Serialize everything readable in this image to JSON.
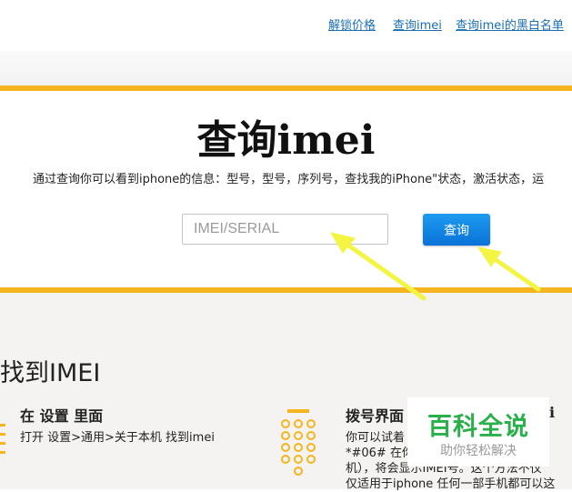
{
  "nav": {
    "links": [
      "解锁价格",
      "查询imei",
      "查询imei的黑白名单"
    ]
  },
  "hero": {
    "title": "查询imei",
    "subtitle": "通过查询你可以看到iphone的信息：型号，型号，序列号，查找我的iPhone\"状态，激活状态，运",
    "input_placeholder": "IMEI/SERIAL",
    "query_label": "查询"
  },
  "lower": {
    "section_title": "找到IMEI",
    "step1": {
      "title": "在 设置 里面",
      "text": "打开 设置>通用>关于本机 找到imei"
    },
    "step2": {
      "title": "拨号界面",
      "title_tail": "i",
      "lines": [
        "你可以试着",
        "*#06# 在你",
        "机），将会显示IMEI号。这个方法不仅",
        "仅适用于iphone 任何一部手机都可以这"
      ]
    }
  },
  "watermark": {
    "main": "百科全说",
    "sub": "助你轻松解决"
  },
  "colors": {
    "accent_orange": "#f5b51f",
    "link_blue": "#1a6fb3",
    "button_blue": "#0a72d8",
    "watermark_green": "#2ab04a",
    "arrow_yellow": "#f4f442"
  }
}
